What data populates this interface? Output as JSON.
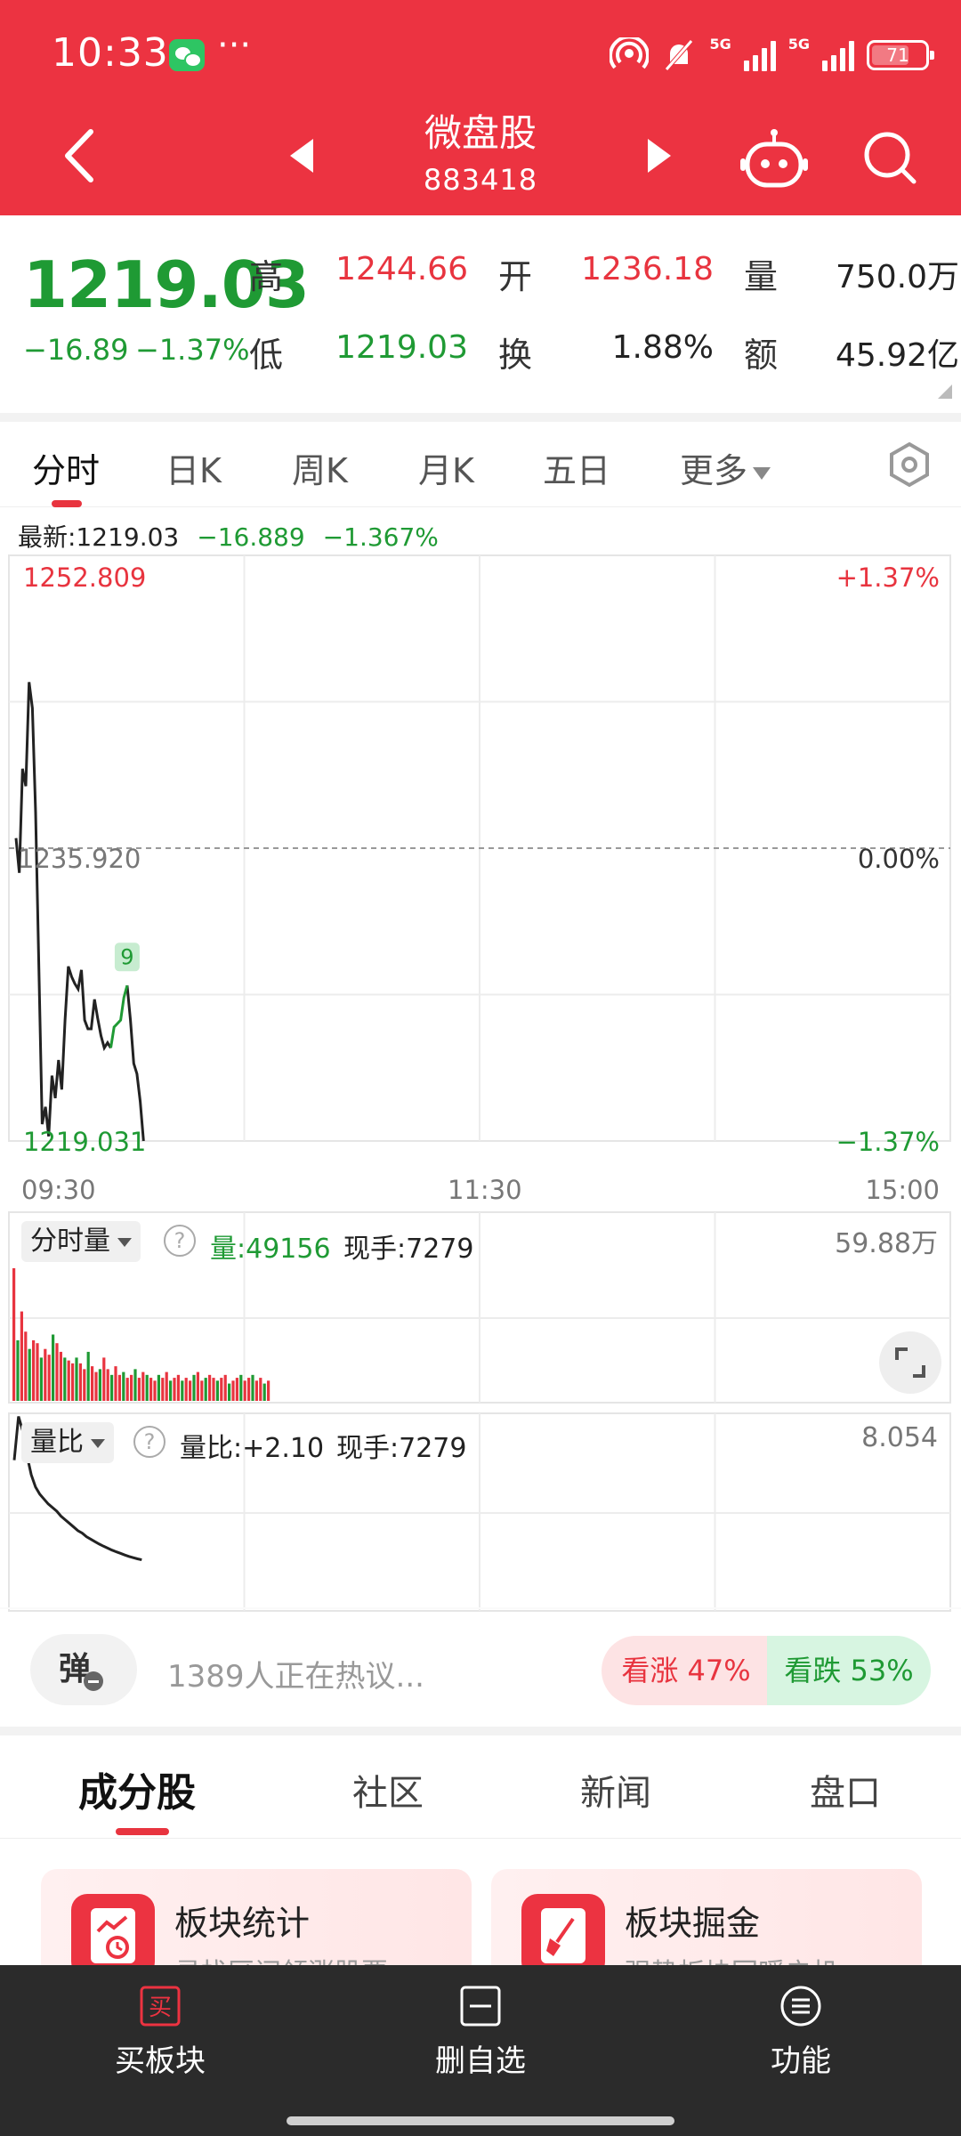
{
  "status": {
    "time": "10:33",
    "more": "···",
    "net1": "5G",
    "net2": "5G",
    "battery": "71",
    "battery_level": 0.71
  },
  "header": {
    "title": "微盘股",
    "code": "883418"
  },
  "quote": {
    "price": "1219.03",
    "change": "−16.89",
    "change_pct": "−1.37%",
    "high_label": "高",
    "high": "1244.66",
    "open_label": "开",
    "open": "1236.18",
    "vol_label": "量",
    "vol": "750.0万",
    "low_label": "低",
    "low": "1219.03",
    "turn_label": "换",
    "turn": "1.88%",
    "amt_label": "额",
    "amt": "45.92亿"
  },
  "tabs": [
    {
      "label": "分时"
    },
    {
      "label": "日K"
    },
    {
      "label": "周K"
    },
    {
      "label": "月K"
    },
    {
      "label": "五日"
    },
    {
      "label": "更多"
    }
  ],
  "chart_data": {
    "type": "line",
    "latest_label": "最新:1219.03",
    "latest_change": "−16.889",
    "latest_pct": "−1.367%",
    "y_top": "1252.809",
    "y_mid": "1235.920",
    "y_bottom": "1219.031",
    "pct_top": "+1.37%",
    "pct_mid": "0.00%",
    "pct_bottom": "−1.37%",
    "x_ticks": [
      "09:30",
      "11:30",
      "15:00"
    ],
    "marker": "9",
    "ylim": [
      1219.031,
      1252.809
    ],
    "price": [
      1236.5,
      1234.5,
      1240.5,
      1239.5,
      1245.5,
      1244,
      1238,
      1229,
      1220,
      1221,
      1219.3,
      1222.8,
      1221.5,
      1223.7,
      1222,
      1226,
      1229.1,
      1228.5,
      1228.1,
      1227.8,
      1228.9,
      1226,
      1225.5,
      1225.5,
      1227.2,
      1226.1,
      1225.1,
      1224.4,
      1224.7,
      1224.4,
      1225.6,
      1225.8,
      1226,
      1227.3,
      1228,
      1226,
      1223.5,
      1222.9,
      1221.3,
      1219.03
    ],
    "volume_label": "分时量",
    "volume_now": "量:49156",
    "volume_hand": "现手:7279",
    "volume_max": "59.88万",
    "volume": [
      0.92,
      0.42,
      0.62,
      0.48,
      0.36,
      0.42,
      0.4,
      0.3,
      0.36,
      0.32,
      0.46,
      0.4,
      0.34,
      0.3,
      0.28,
      0.26,
      0.3,
      0.26,
      0.22,
      0.34,
      0.24,
      0.2,
      0.22,
      0.3,
      0.22,
      0.18,
      0.24,
      0.18,
      0.2,
      0.16,
      0.18,
      0.22,
      0.16,
      0.2,
      0.18,
      0.16,
      0.14,
      0.18,
      0.16,
      0.2,
      0.14,
      0.16,
      0.18,
      0.14,
      0.16,
      0.14,
      0.18,
      0.2,
      0.14,
      0.16,
      0.18,
      0.16,
      0.14,
      0.16,
      0.18,
      0.12,
      0.14,
      0.16,
      0.18,
      0.14,
      0.16,
      0.18,
      0.14,
      0.16,
      0.12,
      0.14
    ],
    "ratio_label": "量比",
    "ratio_now": "量比:+2.10",
    "ratio_hand": "现手:7279",
    "ratio_max": "8.054",
    "ratio": [
      6.2,
      8.0,
      7.4,
      6.4,
      5.6,
      5.1,
      4.8,
      4.6,
      4.4,
      4.25,
      4.1,
      3.9,
      3.75,
      3.6,
      3.45,
      3.3,
      3.2,
      3.05,
      2.95,
      2.85,
      2.75,
      2.66,
      2.58,
      2.5,
      2.43,
      2.37,
      2.3,
      2.24,
      2.19,
      2.14,
      2.1
    ]
  },
  "discuss": {
    "danmu": "弹",
    "text": "1389人正在热议...",
    "up": "看涨 47%",
    "down": "看跌 53%"
  },
  "sections": [
    {
      "label": "成分股"
    },
    {
      "label": "社区"
    },
    {
      "label": "新闻"
    },
    {
      "label": "盘口"
    }
  ],
  "cards": [
    {
      "title": "板块统计",
      "sub": "寻找区间领涨股票"
    },
    {
      "title": "板块掘金",
      "sub": "强势板块回暖启机"
    }
  ],
  "bottom": [
    {
      "label": "买板块",
      "icon_char": "买"
    },
    {
      "label": "删自选"
    },
    {
      "label": "功能"
    }
  ]
}
